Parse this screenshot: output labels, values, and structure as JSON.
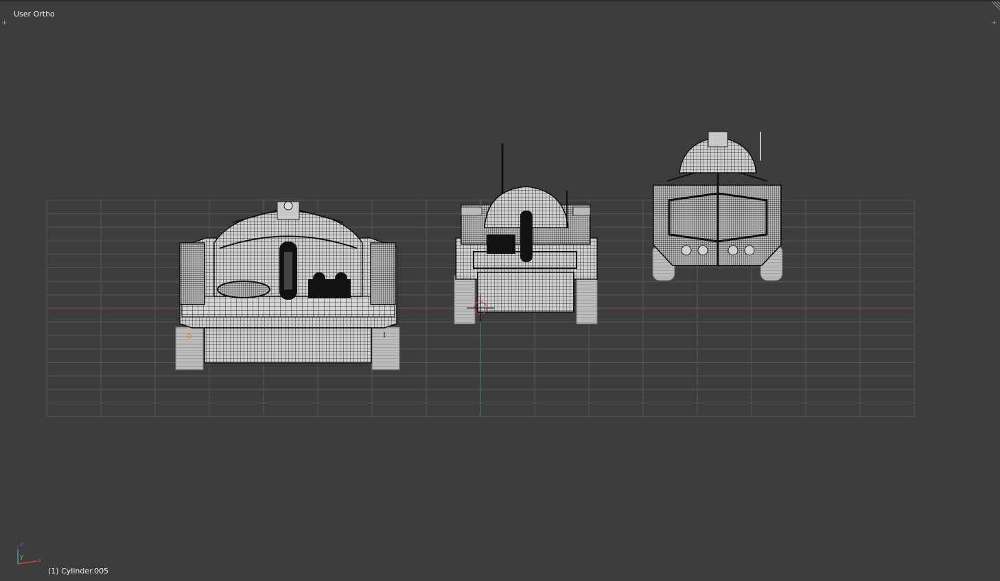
{
  "viewport": {
    "view_label": "User Ortho",
    "object_label": "(1) Cylinder.005",
    "background_color": "#3d3d3d",
    "grid_color": "#575757",
    "x_axis_color": "#8a3a3a",
    "y_axis_color": "#3f8a3f"
  },
  "axis_gizmo": {
    "x_label": "x",
    "y_label": "y",
    "z_label": "z",
    "x_color": "#c84040",
    "y_color": "#58b858",
    "z_color": "#4a6ad0"
  },
  "corner_widgets": {
    "top_left_icon": "plus-icon",
    "top_right_icon": "plus-icon",
    "split_handle_icon": "hatch-icon"
  },
  "tank_views": [
    "front-view-tank-mesh",
    "side-view-tank-mesh",
    "rear-view-tank-mesh"
  ],
  "cursor_3d": "3d-cursor-icon"
}
